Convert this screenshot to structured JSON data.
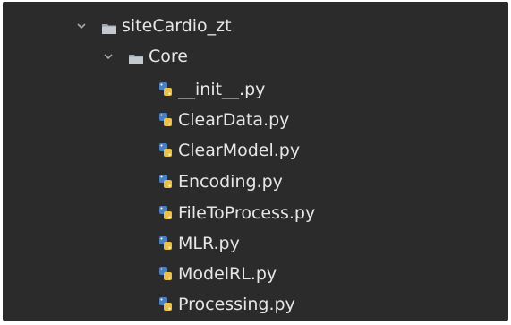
{
  "tree": {
    "root": {
      "label": "siteCardio_zt",
      "expanded": true,
      "icon": "folder-icon"
    },
    "core": {
      "label": "Core",
      "expanded": true,
      "icon": "folder-icon"
    },
    "files": [
      {
        "label": "__init__.py",
        "icon": "python-file-icon"
      },
      {
        "label": "ClearData.py",
        "icon": "python-file-icon"
      },
      {
        "label": "ClearModel.py",
        "icon": "python-file-icon"
      },
      {
        "label": "Encoding.py",
        "icon": "python-file-icon"
      },
      {
        "label": "FileToProcess.py",
        "icon": "python-file-icon"
      },
      {
        "label": "MLR.py",
        "icon": "python-file-icon"
      },
      {
        "label": "ModelRL.py",
        "icon": "python-file-icon"
      },
      {
        "label": "Processing.py",
        "icon": "python-file-icon"
      }
    ]
  },
  "colors": {
    "background": "#2b2b2b",
    "text": "#e6e6e6",
    "chevron": "#a9a9a9",
    "folder": "#9aa3ad",
    "python_blue": "#4a7fc1",
    "python_yellow": "#e8c24a"
  }
}
